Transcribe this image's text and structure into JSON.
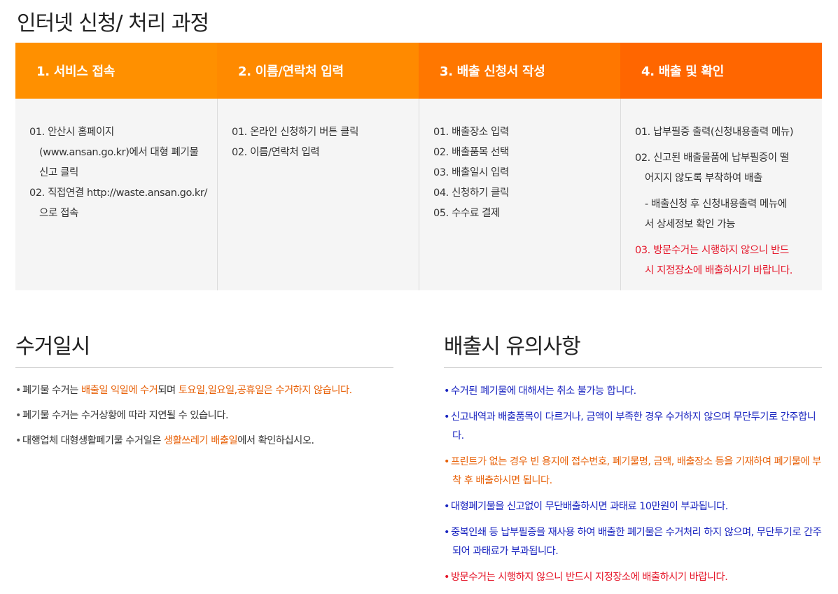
{
  "page_title": "인터넷 신청/ 처리 과정",
  "steps": [
    {
      "title": "1. 서비스 접속",
      "color": "#ff9000",
      "lines": [
        {
          "text": "01. 안산시 홈페이지",
          "indent": false
        },
        {
          "text": "(www.ansan.go.kr)에서 대형 폐기물",
          "indent": true
        },
        {
          "text": "신고 클릭",
          "indent": true
        },
        {
          "text": "02. 직접연결 http://waste.ansan.go.kr/",
          "indent": false
        },
        {
          "text": "으로 접속",
          "indent": true
        }
      ]
    },
    {
      "title": "2. 이름/연락처 입력",
      "color": "#ff8a00",
      "lines": [
        {
          "text": "01. 온라인 신청하기 버튼 클릭",
          "indent": false
        },
        {
          "text": "02. 이름/연락처 입력",
          "indent": false
        }
      ]
    },
    {
      "title": "3. 배출 신청서 작성",
      "color": "#ff7700",
      "lines": [
        {
          "text": "01. 배출장소 입력",
          "indent": false
        },
        {
          "text": "02. 배출품목 선택",
          "indent": false
        },
        {
          "text": "03. 배출일시 입력",
          "indent": false
        },
        {
          "text": "04. 신청하기 클릭",
          "indent": false
        },
        {
          "text": "05. 수수료 결제",
          "indent": false
        }
      ]
    },
    {
      "title": "4. 배출 및 확인",
      "color": "#ff6600",
      "lines": [
        {
          "text": "01. 납부필증 출력(신청내용출력 메뉴)",
          "indent": false,
          "gap": false
        },
        {
          "text": "02. 신고된 배출물품에 납부필증이 떨",
          "indent": false,
          "gap": true
        },
        {
          "text": "어지지 않도록 부착하여 배출",
          "indent": true,
          "gap": false
        },
        {
          "text": "- 배출신청 후 신청내용출력 메뉴에",
          "indent": true,
          "gap": true
        },
        {
          "text": "서 상세정보 확인 가능",
          "indent": true,
          "gap": false
        },
        {
          "text": "03. 방문수거는 시행하지 않으니 반드",
          "indent": false,
          "gap": true,
          "red": true
        },
        {
          "text": "시 지정장소에 배출하시기 바랍니다.",
          "indent": true,
          "gap": false,
          "red": true
        }
      ]
    }
  ],
  "collection": {
    "title": "수거일시",
    "items": [
      [
        {
          "t": "• ",
          "c": "plain"
        },
        {
          "t": "폐기물 수거는 ",
          "c": "plain"
        },
        {
          "t": "배출일 익일에 수거",
          "c": "orange"
        },
        {
          "t": "되며 ",
          "c": "plain"
        },
        {
          "t": "토요일,일요일,공휴일은 수거하지 않습니다.",
          "c": "orange"
        }
      ],
      [
        {
          "t": "• ",
          "c": "plain"
        },
        {
          "t": "폐기물 수거는 수거상황에 따라 지연될 수 있습니다.",
          "c": "plain"
        }
      ],
      [
        {
          "t": "• ",
          "c": "plain"
        },
        {
          "t": "대행업체 대형생활폐기물 수거일은 ",
          "c": "plain"
        },
        {
          "t": "생활쓰레기  배출일",
          "c": "orange"
        },
        {
          "t": "에서 확인하십시오.",
          "c": "plain"
        }
      ]
    ]
  },
  "cautions": {
    "title": "배출시 유의사항",
    "items": [
      {
        "text": "수거된 폐기물에 대해서는 취소 불가능 합니다.",
        "color": "blue"
      },
      {
        "text": "신고내역과 배출품목이 다르거나, 금액이 부족한 경우 수거하지 않으며 무단투기로 간주합니다.",
        "color": "blue"
      },
      {
        "text": "프린트가 없는 경우 빈 용지에 접수번호, 폐기물명, 금액, 배출장소 등을 기재하여 폐기물에 부착 후 배출하시면 됩니다.",
        "color": "orange"
      },
      {
        "text": "대형폐기물을 신고없이 무단배출하시면 과태료 10만원이 부과됩니다.",
        "color": "blue"
      },
      {
        "text": "중복인쇄 등 납부필증을 재사용 하여 배출한 폐기물은 수거처리 하지 않으며, 무단투기로 간주되어 과태료가 부과됩니다.",
        "color": "blue"
      },
      {
        "text": "방문수거는 시행하지 않으니 반드시 지정장소에 배출하시기 바랍니다.",
        "color": "red"
      }
    ]
  }
}
